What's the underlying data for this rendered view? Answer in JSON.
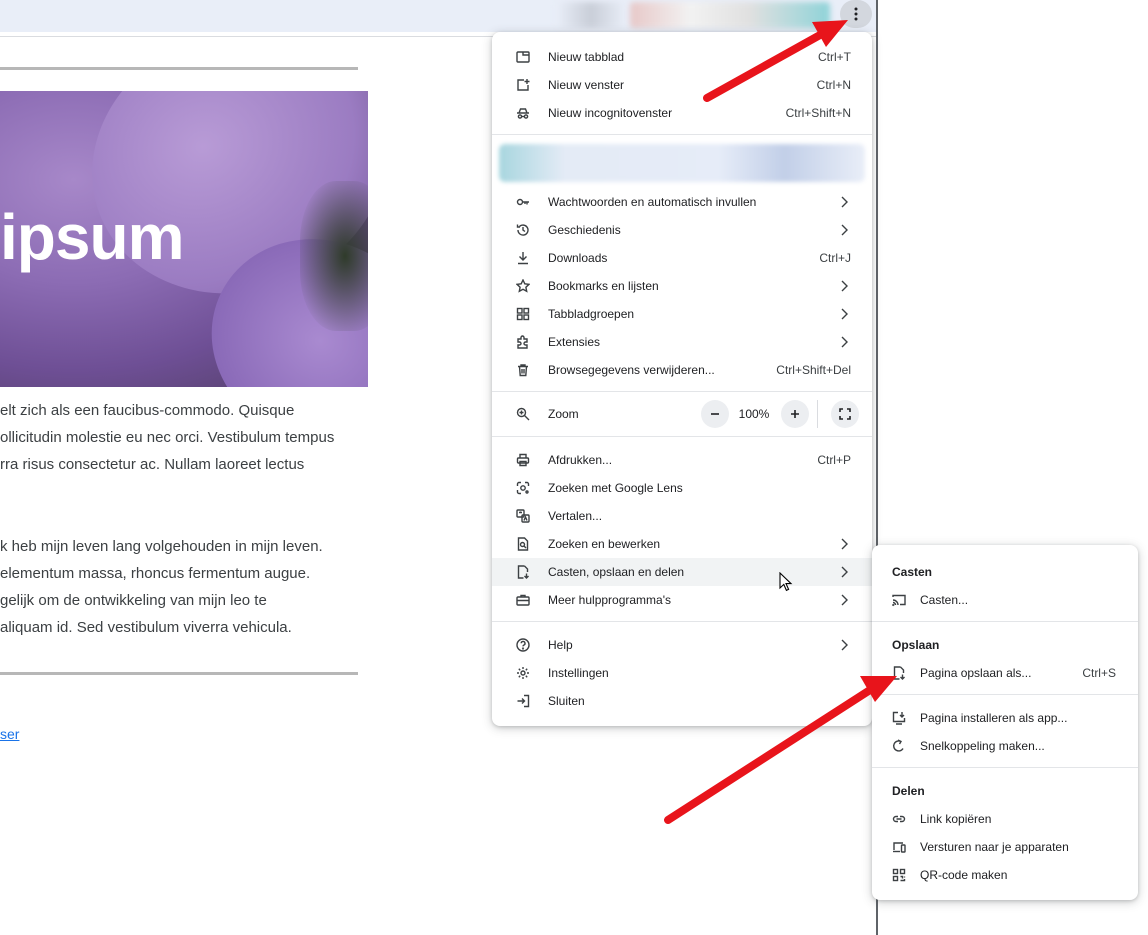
{
  "colors": {
    "accent_red": "#e8141b",
    "link": "#1a73e8",
    "menu_bg": "#ffffff",
    "hover_bg": "#f1f3f4"
  },
  "page": {
    "hero_title": "ipsum",
    "para1": [
      "elt zich als een faucibus-commodo. Quisque",
      "ollicitudin molestie eu nec orci. Vestibulum tempus",
      "rra risus consectetur ac. Nullam laoreet lectus"
    ],
    "para2": [
      "k heb mijn leven lang volgehouden in mijn leven.",
      "elementum massa, rhoncus fermentum augue.",
      "gelijk om de ontwikkeling van mijn leo te",
      "aliquam id. Sed vestibulum viverra vehicula."
    ],
    "link_text": "ser"
  },
  "main_menu": {
    "group1": [
      {
        "icon": "new-tab-icon",
        "label": "Nieuw tabblad",
        "shortcut": "Ctrl+T"
      },
      {
        "icon": "new-window-icon",
        "label": "Nieuw venster",
        "shortcut": "Ctrl+N"
      },
      {
        "icon": "incognito-icon",
        "label": "Nieuw incognitovenster",
        "shortcut": "Ctrl+Shift+N"
      }
    ],
    "group2": [
      {
        "icon": "key-icon",
        "label": "Wachtwoorden en automatisch invullen",
        "shortcut": "",
        "submenu": true
      },
      {
        "icon": "history-icon",
        "label": "Geschiedenis",
        "shortcut": "",
        "submenu": true
      },
      {
        "icon": "download-icon",
        "label": "Downloads",
        "shortcut": "Ctrl+J",
        "submenu": false
      },
      {
        "icon": "star-icon",
        "label": "Bookmarks en lijsten",
        "shortcut": "",
        "submenu": true
      },
      {
        "icon": "tab-groups-icon",
        "label": "Tabbladgroepen",
        "shortcut": "",
        "submenu": true
      },
      {
        "icon": "extension-icon",
        "label": "Extensies",
        "shortcut": "",
        "submenu": true
      },
      {
        "icon": "trash-icon",
        "label": "Browsegegevens verwijderen...",
        "shortcut": "Ctrl+Shift+Del",
        "submenu": false
      }
    ],
    "zoom": {
      "label": "Zoom",
      "value": "100%"
    },
    "group3": [
      {
        "icon": "print-icon",
        "label": "Afdrukken...",
        "shortcut": "Ctrl+P",
        "submenu": false
      },
      {
        "icon": "google-lens-icon",
        "label": "Zoeken met Google Lens",
        "shortcut": "",
        "submenu": false
      },
      {
        "icon": "translate-icon",
        "label": "Vertalen...",
        "shortcut": "",
        "submenu": false
      },
      {
        "icon": "find-edit-icon",
        "label": "Zoeken en bewerken",
        "shortcut": "",
        "submenu": true
      },
      {
        "icon": "cast-save-share-icon",
        "label": "Casten, opslaan en delen",
        "shortcut": "",
        "submenu": true
      },
      {
        "icon": "toolbox-icon",
        "label": "Meer hulpprogramma's",
        "shortcut": "",
        "submenu": true
      }
    ],
    "group4": [
      {
        "icon": "help-icon",
        "label": "Help",
        "shortcut": "",
        "submenu": true
      },
      {
        "icon": "settings-icon",
        "label": "Instellingen",
        "shortcut": "",
        "submenu": false
      },
      {
        "icon": "exit-icon",
        "label": "Sluiten",
        "shortcut": "",
        "submenu": false
      }
    ]
  },
  "sub_menu": {
    "cast_header": "Casten",
    "cast_item": {
      "icon": "cast-icon",
      "label": "Casten...",
      "shortcut": ""
    },
    "save_header": "Opslaan",
    "save_item": {
      "icon": "save-page-icon",
      "label": "Pagina opslaan als...",
      "shortcut": "Ctrl+S"
    },
    "install_items": [
      {
        "icon": "install-app-icon",
        "label": "Pagina installeren als app..."
      },
      {
        "icon": "shortcut-icon",
        "label": "Snelkoppeling maken..."
      }
    ],
    "share_header": "Delen",
    "share_items": [
      {
        "icon": "link-icon",
        "label": "Link kopiëren"
      },
      {
        "icon": "devices-icon",
        "label": "Versturen naar je apparaten"
      },
      {
        "icon": "qr-code-icon",
        "label": "QR-code maken"
      }
    ]
  }
}
